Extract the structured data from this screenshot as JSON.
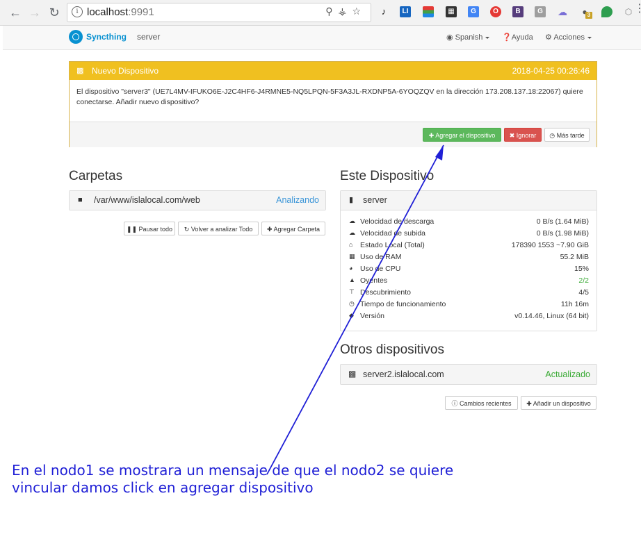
{
  "browser": {
    "url_host": "localhost",
    "url_port": ":9991",
    "back_icon": "arrow-left-icon",
    "forward_icon": "arrow-right-icon",
    "reload_icon": "reload-icon",
    "ext_badge": "3"
  },
  "navbar": {
    "brand": "Syncthing",
    "device": "server",
    "language": "Spanish",
    "help": "Ayuda",
    "actions": "Acciones"
  },
  "notification": {
    "title": "Nuevo Dispositivo",
    "timestamp": "2018-04-25 00:26:46",
    "message": "El dispositivo \"server3\" (UE7L4MV-IFUKO6E-J2C4HF6-J4RMNE5-NQ5LPQN-5F3A3JL-RXDNP5A-6YOQZQV en la dirección 173.208.137.18:22067) quiere conectarse. Añadir nuevo dispositivo?",
    "add_button": "Agregar el dispositivo",
    "ignore_button": "Ignorar",
    "later_button": "Más tarde"
  },
  "folders": {
    "title": "Carpetas",
    "items": [
      {
        "path": "/var/www/islalocal.com/web",
        "status": "Analizando"
      }
    ],
    "pause_all": "Pausar todo",
    "rescan_all": "Volver a analizar Todo",
    "add_folder": "Agregar Carpeta"
  },
  "this_device": {
    "title": "Este Dispositivo",
    "name": "server",
    "rows": [
      {
        "label": "Velocidad de descarga",
        "value": "0 B/s (1.64 MiB)"
      },
      {
        "label": "Velocidad de subida",
        "value": "0 B/s (1.98 MiB)"
      },
      {
        "label": "Estado Local (Total)",
        "value": "178390   1553   ~7.90 GiB"
      },
      {
        "label": "Uso de RAM",
        "value": "55.2 MiB"
      },
      {
        "label": "Uso de CPU",
        "value": "15%"
      },
      {
        "label": "Oyentes",
        "value": "2/2"
      },
      {
        "label": "Descubrimiento",
        "value": "4/5"
      },
      {
        "label": "Tiempo de funcionamiento",
        "value": "11h 16m"
      },
      {
        "label": "Versión",
        "value": "v0.14.46, Linux (64 bit)"
      }
    ]
  },
  "other_devices": {
    "title": "Otros dispositivos",
    "items": [
      {
        "name": "server2.islalocal.com",
        "status": "Actualizado"
      }
    ],
    "recent_changes": "Cambios recientes",
    "add_device": "Añadir un dispositivo"
  },
  "annotation": {
    "line1": "En el nodo1 se mostrara un mensaje de que el nodo2 se quiere",
    "line2": "vincular damos click en agregar dispositivo",
    "color": "#1f1fd6"
  },
  "colors": {
    "warning_header": "#f0c020",
    "success": "#5cb85c",
    "danger": "#d9534f",
    "brand": "#0891d1"
  }
}
